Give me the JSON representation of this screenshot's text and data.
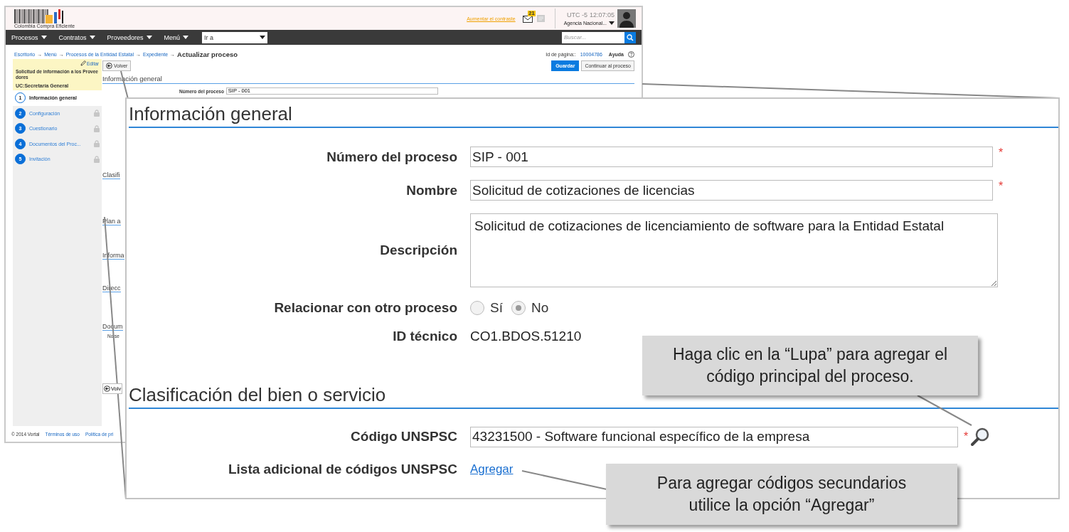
{
  "header": {
    "logo_text": "Colombia Compra Eficiente",
    "contrast_link": "Aumentar el contraste",
    "mail_count": "21",
    "timezone": "UTC -5",
    "time": "12:07:05",
    "agency": "Agencia Nacional..."
  },
  "nav": {
    "menus": [
      "Procesos",
      "Contratos",
      "Proveedores",
      "Menú"
    ],
    "goto": "Ir a",
    "search_placeholder": "Buscar..."
  },
  "breadcrumb": {
    "links": [
      "Escritorio",
      "Menú",
      "Procesos de la Entidad Estatal",
      "Expediente"
    ],
    "arrows": [
      "→",
      "→",
      "→",
      "→"
    ],
    "current": "Actualizar proceso"
  },
  "page_id": {
    "label": "Id de página::",
    "value": "10004786",
    "help": "Ayuda"
  },
  "sidebar": {
    "edit": "Editar",
    "process_title": "Solicitud de información a los Proveedores",
    "unit": "UC:Secretaría General",
    "steps": [
      {
        "number": "1",
        "label": "Información general",
        "selected": true,
        "locked": false
      },
      {
        "number": "2",
        "label": "Configuración",
        "selected": false,
        "locked": true
      },
      {
        "number": "3",
        "label": "Cuestionario",
        "selected": false,
        "locked": true
      },
      {
        "number": "4",
        "label": "Documentos del Proc...",
        "selected": false,
        "locked": true
      },
      {
        "number": "5",
        "label": "Invitación",
        "selected": false,
        "locked": true
      }
    ]
  },
  "main": {
    "back": "Volver",
    "save": "Guardar",
    "continue": "Continuar al proceso",
    "section": "Información general",
    "field_label": "Número del proceso",
    "field_value": "SIP - 001",
    "cut_sections": [
      "Clasifi",
      "Plan a",
      "Informa",
      "Direcc",
      "Docum"
    ],
    "note": "No se",
    "bottom_back": "Volv"
  },
  "footer": {
    "copyright": "© 2014 Vortal",
    "links": [
      "Términos de uso",
      "Política de pri"
    ]
  },
  "zoom_panel": {
    "title": "Información general",
    "fields": [
      {
        "kind": "text",
        "label": "Número del proceso",
        "value": "SIP - 001",
        "required_mark": "*"
      },
      {
        "kind": "text",
        "label": "Nombre",
        "value": "Solicitud de cotizaciones de licencias",
        "required_mark": "*"
      },
      {
        "kind": "textarea",
        "label": "Descripción",
        "value": "Solicitud de cotizaciones de licenciamiento de software para la Entidad Estatal"
      },
      {
        "kind": "radio",
        "label": "Relacionar con otro proceso",
        "options": [
          {
            "label": "Sí",
            "selected": false
          },
          {
            "label": "No",
            "selected": true
          }
        ]
      },
      {
        "kind": "readonly",
        "label": "ID técnico",
        "value": "CO1.BDOS.51210"
      }
    ],
    "classification_title": "Clasificación del bien o servicio",
    "unspsc": {
      "label": "Código UNSPSC",
      "value": "43231500 - Software funcional específico de la empresa",
      "required_mark": "*"
    },
    "additional": {
      "label": "Lista adicional de códigos UNSPSC",
      "link": "Agregar"
    }
  },
  "callouts": [
    "Haga clic en la “Lupa” para agregar el código principal del proceso.",
    "Para agregar códigos secundarios utilice la opción “Agregar”"
  ]
}
